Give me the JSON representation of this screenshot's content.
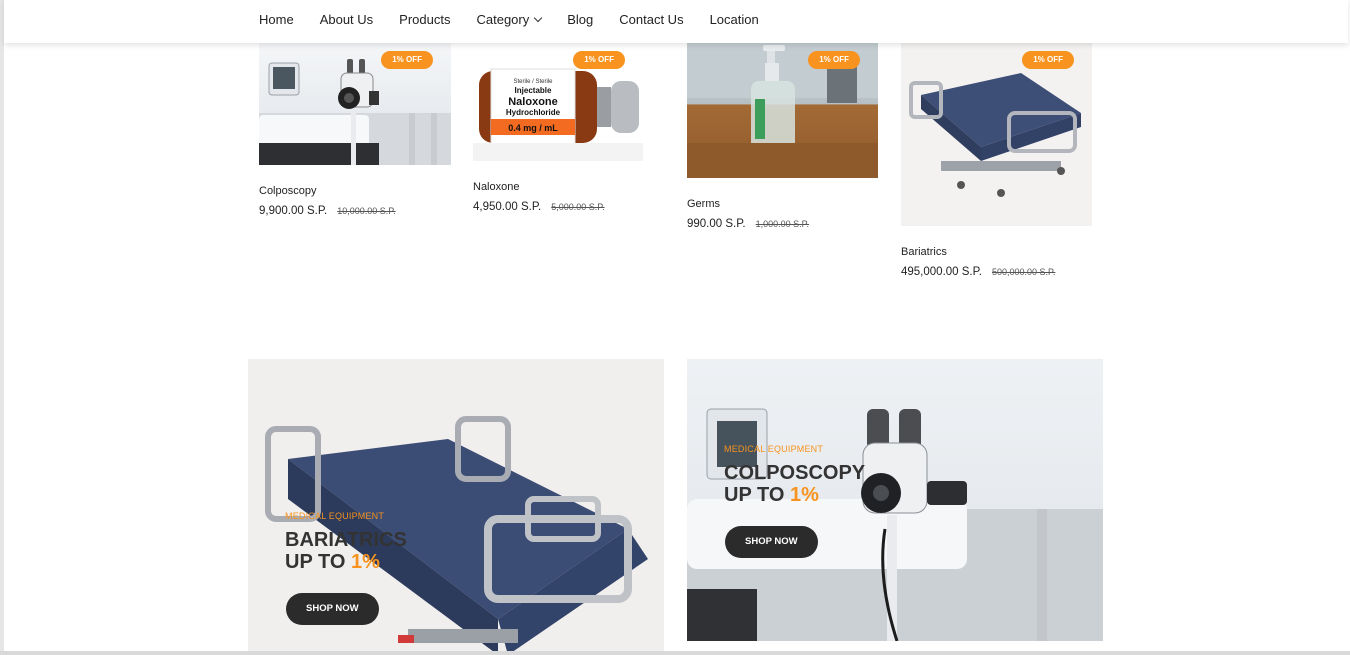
{
  "nav": {
    "items": [
      {
        "label": "Home"
      },
      {
        "label": "About Us"
      },
      {
        "label": "Products"
      },
      {
        "label": "Category",
        "has_dropdown": true
      },
      {
        "label": "Blog"
      },
      {
        "label": "Contact Us"
      },
      {
        "label": "Location"
      }
    ]
  },
  "products": [
    {
      "name": "Colposcopy",
      "price": "9,900.00 S.P.",
      "old_price": "10,000.00 S.P.",
      "badge": "1% OFF",
      "image": "colposcope-photo"
    },
    {
      "name": "Naloxone",
      "price": "4,950.00 S.P.",
      "old_price": "5,000.00 S.P.",
      "badge": "1% OFF",
      "image": "naloxone-vial-photo"
    },
    {
      "name": "Germs",
      "price": "990.00 S.P.",
      "old_price": "1,000.00 S.P.",
      "badge": "1% OFF",
      "image": "hand-sanitizer-photo"
    },
    {
      "name": "Bariatrics",
      "price": "495,000.00 S.P.",
      "old_price": "500,000.00 S.P.",
      "badge": "1% OFF",
      "image": "hospital-bed-photo"
    }
  ],
  "naloxone_label": {
    "line1": "Sterile / Sterile",
    "line2": "Injectable",
    "line3": "Naloxone",
    "line4": "Hydrochloride",
    "line5": "0.4 mg / mL"
  },
  "banners": [
    {
      "subtitle": "MEDICAL EQUIPMENT",
      "title_line1": "BARIATRICS",
      "title_line2_prefix": "UP TO ",
      "title_highlight": "1%",
      "button": "SHOP NOW",
      "image": "hospital-bed-photo"
    },
    {
      "subtitle": "MEDICAL EQUIPMENT",
      "title_line1": "COLPOSCOPY",
      "title_line2_prefix": "UP TO ",
      "title_highlight": "1%",
      "button": "SHOP NOW",
      "image": "colposcope-photo"
    }
  ],
  "colors": {
    "accent": "#f7931e",
    "button": "#2b2b2b",
    "text": "#222222"
  }
}
